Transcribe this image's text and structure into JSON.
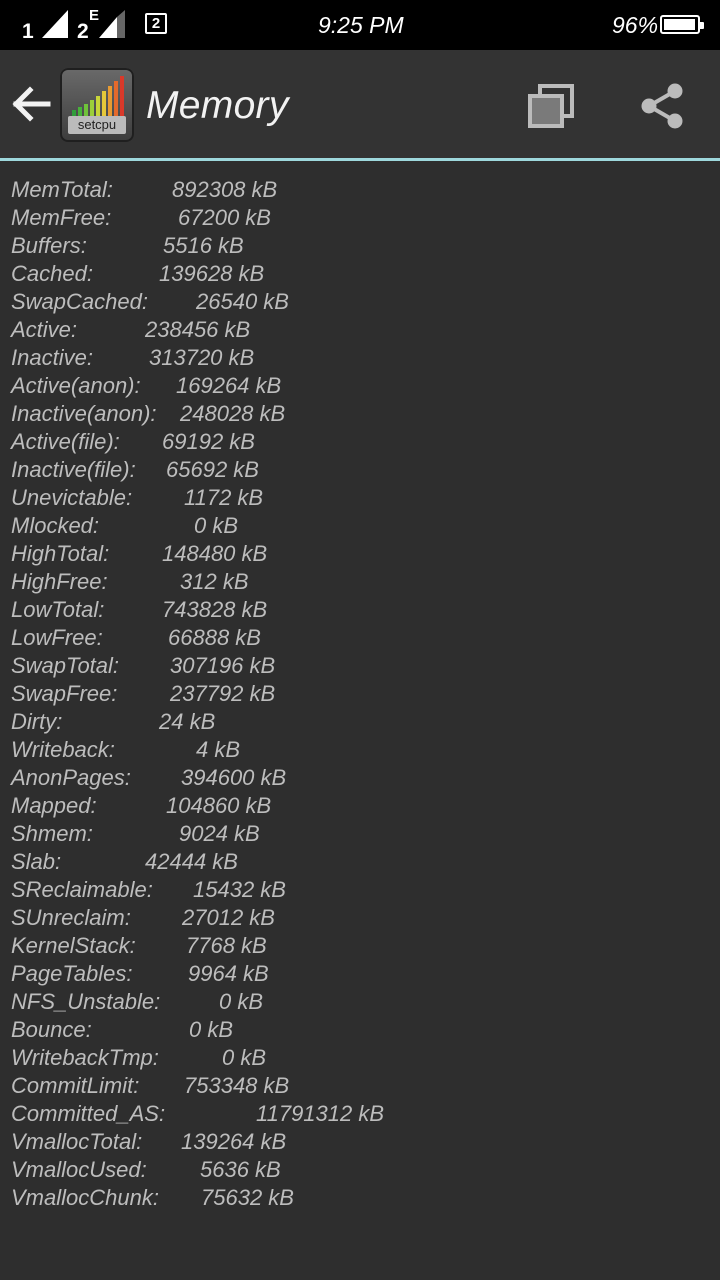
{
  "status_bar": {
    "sim1": "1",
    "sim2": "2",
    "sim2_network": "E",
    "notification_count": "2",
    "time": "9:25 PM",
    "battery": "96%",
    "battery_level": 0.96
  },
  "app_bar": {
    "icon_label": "setcpu",
    "title": "Memory"
  },
  "memory": [
    {
      "key": "MemTotal:",
      "value": "892308 kB"
    },
    {
      "key": "MemFree:",
      "value": "67200 kB"
    },
    {
      "key": "Buffers:",
      "value": "5516 kB"
    },
    {
      "key": "Cached:",
      "value": "139628 kB"
    },
    {
      "key": "SwapCached:",
      "value": "26540 kB"
    },
    {
      "key": "Active:",
      "value": "238456 kB"
    },
    {
      "key": "Inactive:",
      "value": "313720 kB"
    },
    {
      "key": "Active(anon):",
      "value": "169264 kB"
    },
    {
      "key": "Inactive(anon):",
      "value": "248028 kB"
    },
    {
      "key": "Active(file):",
      "value": "69192 kB"
    },
    {
      "key": "Inactive(file):",
      "value": "65692 kB"
    },
    {
      "key": "Unevictable:",
      "value": "1172 kB"
    },
    {
      "key": "Mlocked:",
      "value": "0 kB"
    },
    {
      "key": "HighTotal:",
      "value": "148480 kB"
    },
    {
      "key": "HighFree:",
      "value": "312 kB"
    },
    {
      "key": "LowTotal:",
      "value": "743828 kB"
    },
    {
      "key": "LowFree:",
      "value": "66888 kB"
    },
    {
      "key": "SwapTotal:",
      "value": "307196 kB"
    },
    {
      "key": "SwapFree:",
      "value": "237792 kB"
    },
    {
      "key": "Dirty:",
      "value": "24 kB"
    },
    {
      "key": "Writeback:",
      "value": "4 kB"
    },
    {
      "key": "AnonPages:",
      "value": "394600 kB"
    },
    {
      "key": "Mapped:",
      "value": "104860 kB"
    },
    {
      "key": "Shmem:",
      "value": "9024 kB"
    },
    {
      "key": "Slab:",
      "value": "42444 kB"
    },
    {
      "key": "SReclaimable:",
      "value": "15432 kB"
    },
    {
      "key": "SUnreclaim:",
      "value": "27012 kB"
    },
    {
      "key": "KernelStack:",
      "value": "7768 kB"
    },
    {
      "key": "PageTables:",
      "value": "9964 kB"
    },
    {
      "key": "NFS_Unstable:",
      "value": "0 kB"
    },
    {
      "key": "Bounce:",
      "value": "0 kB"
    },
    {
      "key": "WritebackTmp:",
      "value": "0 kB"
    },
    {
      "key": "CommitLimit:",
      "value": "753348 kB"
    },
    {
      "key": "Committed_AS:",
      "value": "11791312 kB"
    },
    {
      "key": "VmallocTotal:",
      "value": "139264 kB"
    },
    {
      "key": "VmallocUsed:",
      "value": "5636 kB"
    },
    {
      "key": "VmallocChunk:",
      "value": "75632 kB"
    }
  ]
}
